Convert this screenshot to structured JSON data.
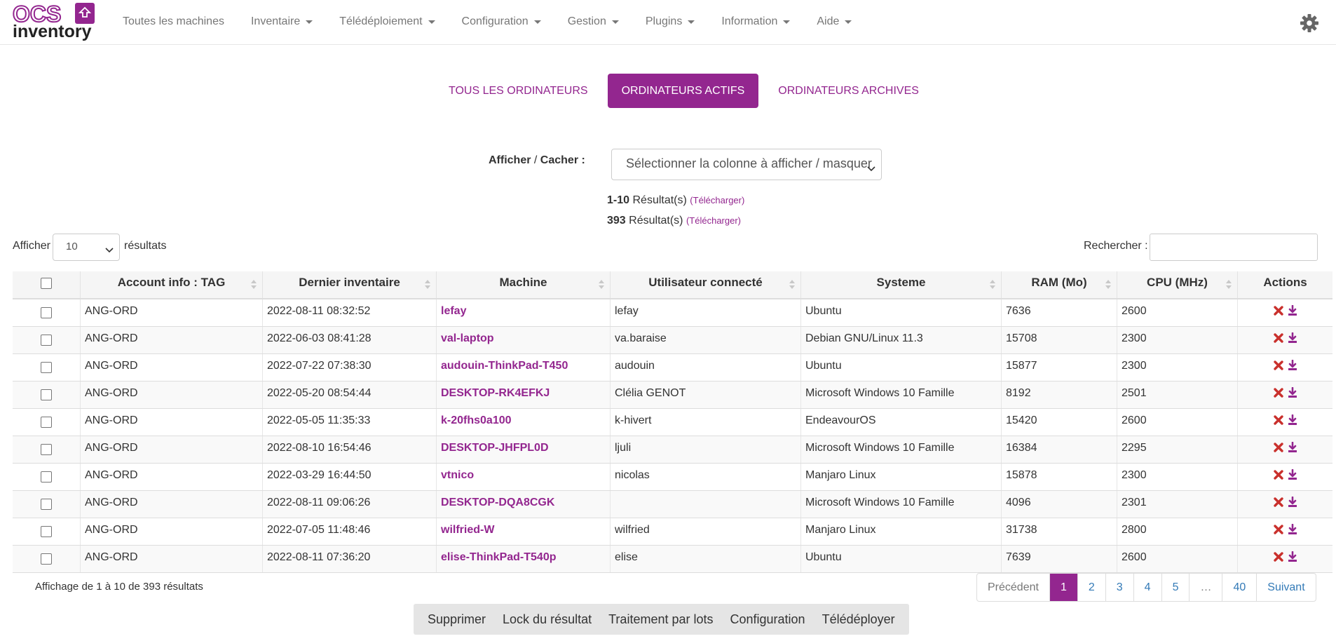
{
  "brand": {
    "logo_top": "OCS",
    "logo_bottom": "inventory",
    "accent": "#93268f"
  },
  "nav": [
    {
      "label": "Toutes les machines",
      "caret": false
    },
    {
      "label": "Inventaire",
      "caret": true
    },
    {
      "label": "Télédéploiement",
      "caret": true
    },
    {
      "label": "Configuration",
      "caret": true
    },
    {
      "label": "Gestion",
      "caret": true
    },
    {
      "label": "Plugins",
      "caret": true
    },
    {
      "label": "Information",
      "caret": true
    },
    {
      "label": "Aide",
      "caret": true
    }
  ],
  "tabs": [
    {
      "label": "TOUS LES ORDINATEURS",
      "active": false
    },
    {
      "label": "ORDINATEURS ACTIFS",
      "active": true
    },
    {
      "label": "ORDINATEURS ARCHIVES",
      "active": false
    }
  ],
  "columns_toggle": {
    "label_a": "Afficher",
    "sep": " / ",
    "label_b": "Cacher :",
    "placeholder": "Sélectionner la colonne à afficher / masquer"
  },
  "results": {
    "range": "1-10",
    "range_text": "Résultat(s)",
    "total": "393",
    "total_text": "Résultat(s)",
    "download": "(Télécharger)"
  },
  "length": {
    "before": "Afficher",
    "value": "10",
    "after": "résultats"
  },
  "search": {
    "label": "Rechercher :",
    "value": ""
  },
  "table": {
    "headers": [
      "Account info : TAG",
      "Dernier inventaire",
      "Machine",
      "Utilisateur connecté",
      "Systeme",
      "RAM (Mo)",
      "CPU (MHz)",
      "Actions"
    ],
    "rows": [
      {
        "tag": "ANG-ORD",
        "date": "2022-08-11 08:32:52",
        "machine": "lefay",
        "user": "lefay",
        "os": "Ubuntu",
        "ram": "7636",
        "cpu": "2600"
      },
      {
        "tag": "ANG-ORD",
        "date": "2022-06-03 08:41:28",
        "machine": "val-laptop",
        "user": "va.baraise",
        "os": "Debian GNU/Linux 11.3",
        "ram": "15708",
        "cpu": "2300"
      },
      {
        "tag": "ANG-ORD",
        "date": "2022-07-22 07:38:30",
        "machine": "audouin-ThinkPad-T450",
        "user": "audouin",
        "os": "Ubuntu",
        "ram": "15877",
        "cpu": "2300"
      },
      {
        "tag": "ANG-ORD",
        "date": "2022-05-20 08:54:44",
        "machine": "DESKTOP-RK4EFKJ",
        "user": "Clélia GENOT",
        "os": "Microsoft Windows 10 Famille",
        "ram": "8192",
        "cpu": "2501"
      },
      {
        "tag": "ANG-ORD",
        "date": "2022-05-05 11:35:33",
        "machine": "k-20fhs0a100",
        "user": "k-hivert",
        "os": "EndeavourOS",
        "ram": "15420",
        "cpu": "2600"
      },
      {
        "tag": "ANG-ORD",
        "date": "2022-08-10 16:54:46",
        "machine": "DESKTOP-JHFPL0D",
        "user": "ljuli",
        "os": "Microsoft Windows 10 Famille",
        "ram": "16384",
        "cpu": "2295"
      },
      {
        "tag": "ANG-ORD",
        "date": "2022-03-29 16:44:50",
        "machine": "vtnico",
        "user": "nicolas",
        "os": "Manjaro Linux",
        "ram": "15878",
        "cpu": "2300"
      },
      {
        "tag": "ANG-ORD",
        "date": "2022-08-11 09:06:26",
        "machine": "DESKTOP-DQA8CGK",
        "user": "",
        "os": "Microsoft Windows 10 Famille",
        "ram": "4096",
        "cpu": "2301"
      },
      {
        "tag": "ANG-ORD",
        "date": "2022-07-05 11:48:46",
        "machine": "wilfried-W",
        "user": "wilfried",
        "os": "Manjaro Linux",
        "ram": "31738",
        "cpu": "2800"
      },
      {
        "tag": "ANG-ORD",
        "date": "2022-08-11 07:36:20",
        "machine": "elise-ThinkPad-T540p",
        "user": "elise",
        "os": "Ubuntu",
        "ram": "7639",
        "cpu": "2600"
      }
    ]
  },
  "footer": {
    "info": "Affichage de 1 à 10 de 393 résultats",
    "pagination": [
      {
        "label": "Précédent",
        "state": "disabled"
      },
      {
        "label": "1",
        "state": "active"
      },
      {
        "label": "2",
        "state": ""
      },
      {
        "label": "3",
        "state": ""
      },
      {
        "label": "4",
        "state": ""
      },
      {
        "label": "5",
        "state": ""
      },
      {
        "label": "…",
        "state": "disabled"
      },
      {
        "label": "40",
        "state": ""
      },
      {
        "label": "Suivant",
        "state": ""
      }
    ],
    "actions": [
      "Supprimer",
      "Lock du résultat",
      "Traitement par lots",
      "Configuration",
      "Télédéployer"
    ]
  },
  "icons": {
    "delete": "delete-x-icon",
    "download": "download-icon",
    "settings": "gear-icon",
    "delete_color": "#c9302c"
  }
}
